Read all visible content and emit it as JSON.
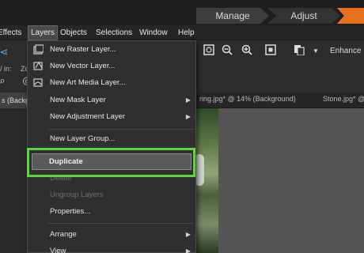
{
  "workspace_tabs": [
    "Manage",
    "Adjust"
  ],
  "menubar": {
    "items": [
      "Effects",
      "Layers",
      "Objects",
      "Selections",
      "Window",
      "Help"
    ],
    "active": "Layers"
  },
  "toolbar": {
    "enhance_label": "Enhance P",
    "left_fragment_1": "/ in:",
    "left_fragment_2": "Zo",
    "icons": [
      "zoom-fit-icon",
      "zoom-out-icon",
      "zoom-in-icon",
      "actual-size-icon",
      "paste-icon",
      "dropdown-arrow-icon"
    ]
  },
  "tabs": {
    "left": "s (Backgr",
    "middle": "ring.jpg* @ 14% (Background)",
    "right": "Stone.jpg* @"
  },
  "layers_menu": {
    "items": [
      {
        "label": "New Raster Layer...",
        "disabled": false,
        "submenu": false
      },
      {
        "label": "New Vector Layer...",
        "disabled": false,
        "submenu": false
      },
      {
        "label": "New Art Media Layer...",
        "disabled": false,
        "submenu": false
      },
      {
        "label": "New Mask Layer",
        "disabled": false,
        "submenu": true
      },
      {
        "label": "New Adjustment Layer",
        "disabled": false,
        "submenu": true
      },
      {
        "label": "New Layer Group...",
        "disabled": false,
        "submenu": false
      },
      {
        "label": "Duplicate",
        "disabled": false,
        "submenu": false,
        "highlighted": true
      },
      {
        "label": "Delete",
        "disabled": true,
        "submenu": false
      },
      {
        "label": "Ungroup Layers",
        "disabled": true,
        "submenu": false
      },
      {
        "label": "Properties...",
        "disabled": false,
        "submenu": false
      },
      {
        "label": "Arrange",
        "disabled": false,
        "submenu": true
      },
      {
        "label": "View",
        "disabled": false,
        "submenu": true
      }
    ]
  },
  "colors": {
    "highlight_border": "#5fd63a",
    "accent_tab": "#e8711e"
  }
}
